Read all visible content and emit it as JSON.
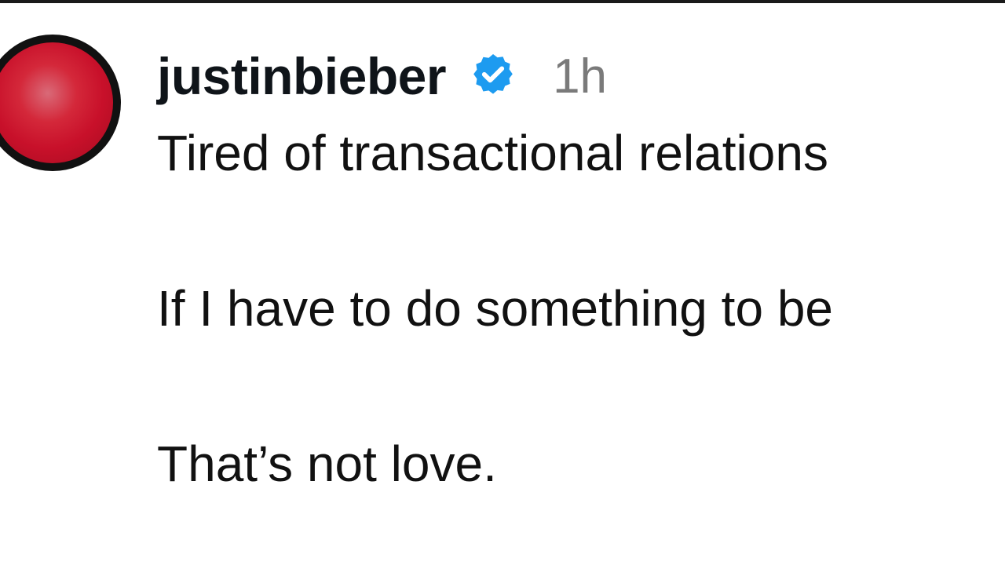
{
  "post": {
    "author": {
      "username": "justinbieber",
      "verified": true,
      "avatar_color": "#c8102a"
    },
    "timestamp": "1h",
    "lines": [
      "Tired of transactional relations",
      "If I have to do something to be",
      "That’s not love."
    ]
  },
  "colors": {
    "verified_badge": "#1d9bf0",
    "timestamp": "#7a7a7a",
    "text": "#111111"
  }
}
